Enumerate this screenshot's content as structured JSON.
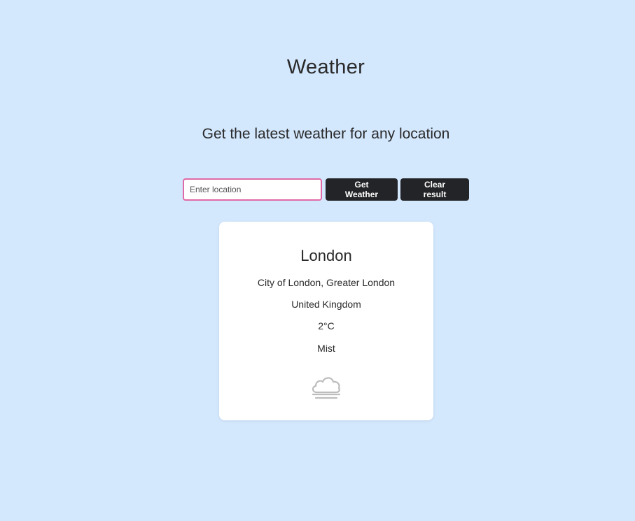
{
  "header": {
    "title": "Weather",
    "subtitle": "Get the latest weather for any location"
  },
  "search": {
    "placeholder": "Enter location",
    "value": "",
    "get_button_label": "Get Weather",
    "clear_button_label": "Clear result"
  },
  "result": {
    "city": "London",
    "region": "City of London, Greater London",
    "country": "United Kingdom",
    "temperature": "2°C",
    "condition": "Mist",
    "icon": "mist-cloud-icon"
  },
  "colors": {
    "background": "#d3e7fd",
    "button": "#232427",
    "input_border": "#e06aa7",
    "card": "#ffffff"
  }
}
